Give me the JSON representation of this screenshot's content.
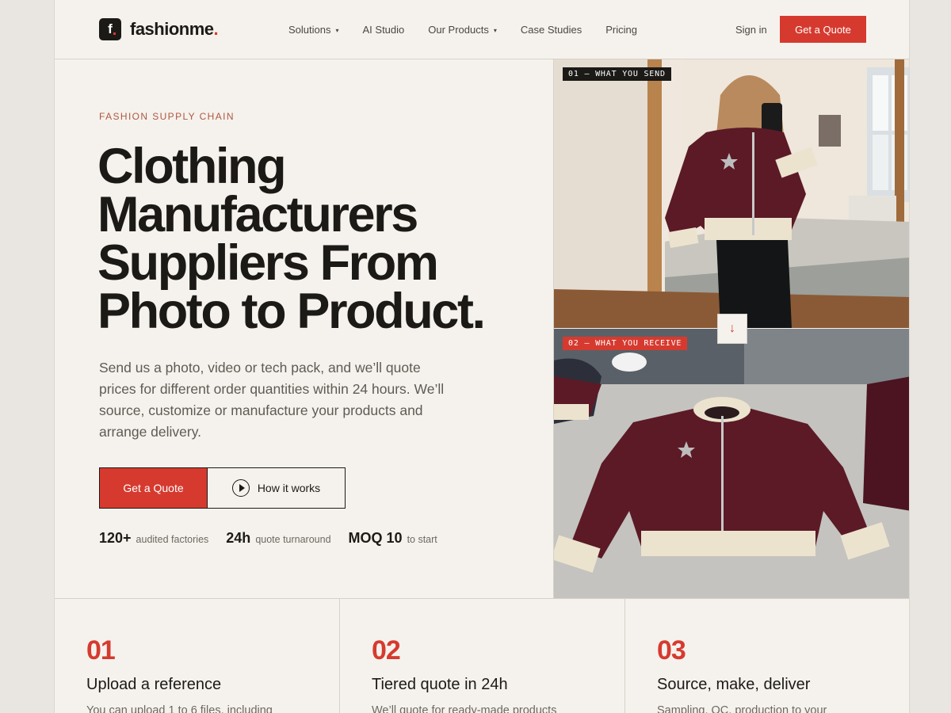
{
  "brand": {
    "logo_letter": "f",
    "name": "fashionme",
    "dot": "."
  },
  "nav": {
    "items": [
      {
        "label": "Solutions",
        "has_caret": true
      },
      {
        "label": "AI Studio",
        "has_caret": false
      },
      {
        "label": "Our Products",
        "has_caret": true
      },
      {
        "label": "Case Studies",
        "has_caret": false
      },
      {
        "label": "Pricing",
        "has_caret": false
      }
    ],
    "caret": "▾",
    "sign_in": "Sign in",
    "cta": "Get a Quote"
  },
  "hero": {
    "eyebrow": "FASHION SUPPLY CHAIN",
    "headline": [
      "Clothing",
      "Manufacturers",
      "Suppliers From",
      "Photo to Product."
    ],
    "description": "Send us a photo, video or tech pack, and we’ll quote prices for different order quantities within 24 hours. We’ll source, customize or manufacture your products and arrange delivery.",
    "primary_button": "Get a Quote",
    "secondary_button": "How it works",
    "stats": [
      {
        "value": "120+",
        "label": "audited factories"
      },
      {
        "value": "24h",
        "label": "quote turnaround"
      },
      {
        "value": "MOQ 10",
        "label": "to start"
      }
    ]
  },
  "gallery": {
    "tag_send": "01 — WHAT YOU SEND",
    "tag_receive": "02 — WHAT YOU RECEIVE",
    "arrow": "↓"
  },
  "steps": [
    {
      "number": "01",
      "title": "Upload a reference",
      "text": "You can upload 1 to 6 files, including"
    },
    {
      "number": "02",
      "title": "Tiered quote in 24h",
      "text": "We’ll quote for ready-made products"
    },
    {
      "number": "03",
      "title": "Source, make, deliver",
      "text": "Sampling, QC, production to your"
    }
  ],
  "colors": {
    "accent": "#d63a2f",
    "ink": "#1c1a17",
    "background": "#f5f2ed",
    "jacket": "#5b1a26"
  }
}
